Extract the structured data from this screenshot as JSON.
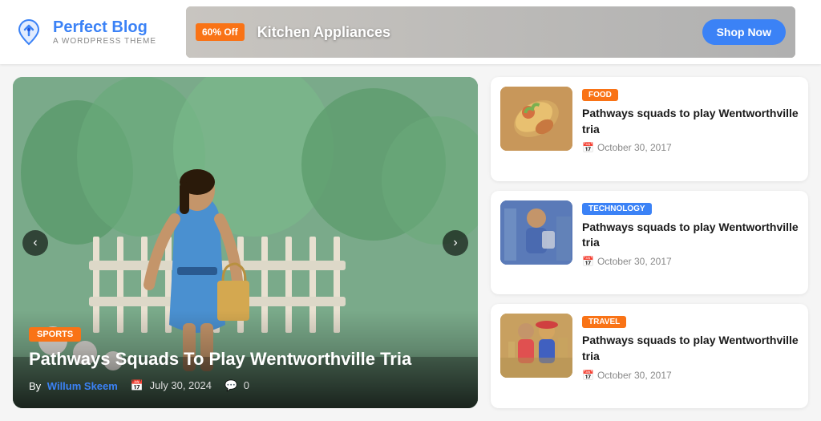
{
  "header": {
    "logo": {
      "title_plain": "Perfect ",
      "title_accent": "Blog",
      "subtitle": "A WordPress Theme"
    },
    "banner": {
      "discount": "60% Off",
      "title": "Kitchen Appliances",
      "shop_button": "Shop Now"
    }
  },
  "hero": {
    "category": "SPORTS",
    "title": "Pathways Squads To Play Wentworthville Tria",
    "author_prefix": "By",
    "author_name": "Willum Skeem",
    "date": "July 30, 2024",
    "comments": "0",
    "arrow_left": "‹",
    "arrow_right": "›"
  },
  "articles": [
    {
      "category": "FOOD",
      "category_class": "cat-food",
      "thumb_class": "thumb-food",
      "thumb_emoji": "🌯",
      "title": "Pathways squads to play Wentworthville tria",
      "date": "October 30, 2017"
    },
    {
      "category": "TECHNOLOGY",
      "category_class": "cat-tech",
      "thumb_class": "thumb-tech",
      "thumb_emoji": "👨",
      "title": "Pathways squads to play Wentworthville tria",
      "date": "October 30, 2017"
    },
    {
      "category": "TRAVEL",
      "category_class": "cat-travel",
      "thumb_class": "thumb-travel",
      "thumb_emoji": "🧑‍🤝‍🧑",
      "title": "Pathways squads to play Wentworthville tria",
      "date": "October 30, 2017"
    }
  ]
}
